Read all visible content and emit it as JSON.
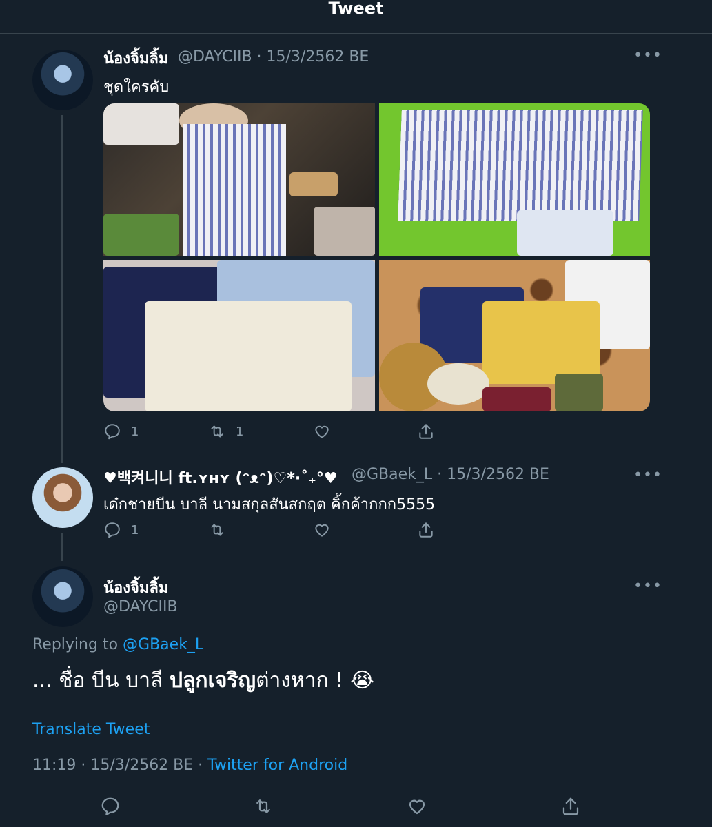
{
  "header": {
    "title": "Tweet"
  },
  "tweets": [
    {
      "name": "น้องจิ้มลิ้ม",
      "handle_date": "@DAYCIIB · 15/3/2562 BE",
      "text": "ชุดใครคับ",
      "reply_count": "1",
      "retweet_count": "1"
    },
    {
      "name": "♥백켜니니 ft.ʏʜʏ (ᵔᴥᵔ)♡*·˚₊°♥",
      "handle_date": "@GBaek_L · 15/3/2562 BE",
      "text": "เด๋กชายบีน บาลี นามสกุลสันสกฤต คิ้กค้ากกก5555",
      "reply_count": "1"
    }
  ],
  "main_tweet": {
    "name": "น้องจิ้มลิ้ม",
    "handle": "@DAYCIIB",
    "replying_prefix": "Replying to ",
    "replying_handle": "@GBaek_L",
    "text_part1": "... ชื่อ บีน บาลี ",
    "text_bold": "ปลูกเจริญ",
    "text_part2": "ต่างหาก ! 😭",
    "translate": "Translate Tweet",
    "time_date": "11:19 · 15/3/2562 BE · ",
    "source": "Twitter for Android"
  },
  "icons": {
    "more": "more-horizontal-icon",
    "reply": "reply-icon",
    "retweet": "retweet-icon",
    "like": "heart-icon",
    "share": "share-icon"
  },
  "colors": {
    "background": "#15202b",
    "secondary_text": "#8899a6",
    "link": "#1da1f2",
    "divider": "#38444d"
  }
}
